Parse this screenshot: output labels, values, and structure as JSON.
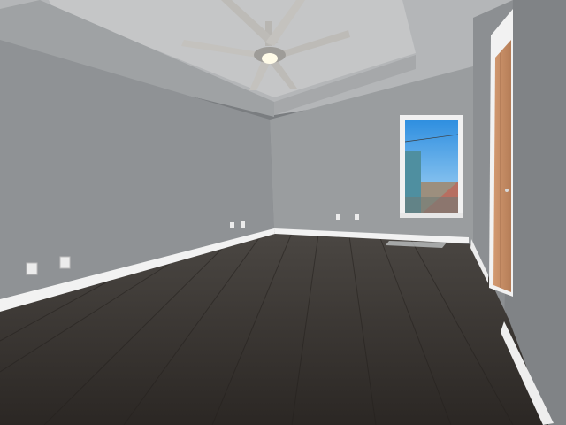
{
  "scene": {
    "description_free": true,
    "colors": {
      "ceiling": "#c9cacb",
      "ceiling_shadow": "#a9abad",
      "wall_left": "#8e9194",
      "wall_back": "#9a9d9f",
      "wall_right": "#85888b",
      "trim": "#f2f2f2",
      "floor_dark": "#2e2a27",
      "floor_light": "#5a5652",
      "sky": "#4aa3e8",
      "door": "#c58e66",
      "fan": "#b9b7b3",
      "light": "#fffbe8"
    },
    "objects": [
      "ceiling-fan-icon",
      "window-icon",
      "door-icon",
      "outlet-icon",
      "hardwood-floor"
    ]
  }
}
